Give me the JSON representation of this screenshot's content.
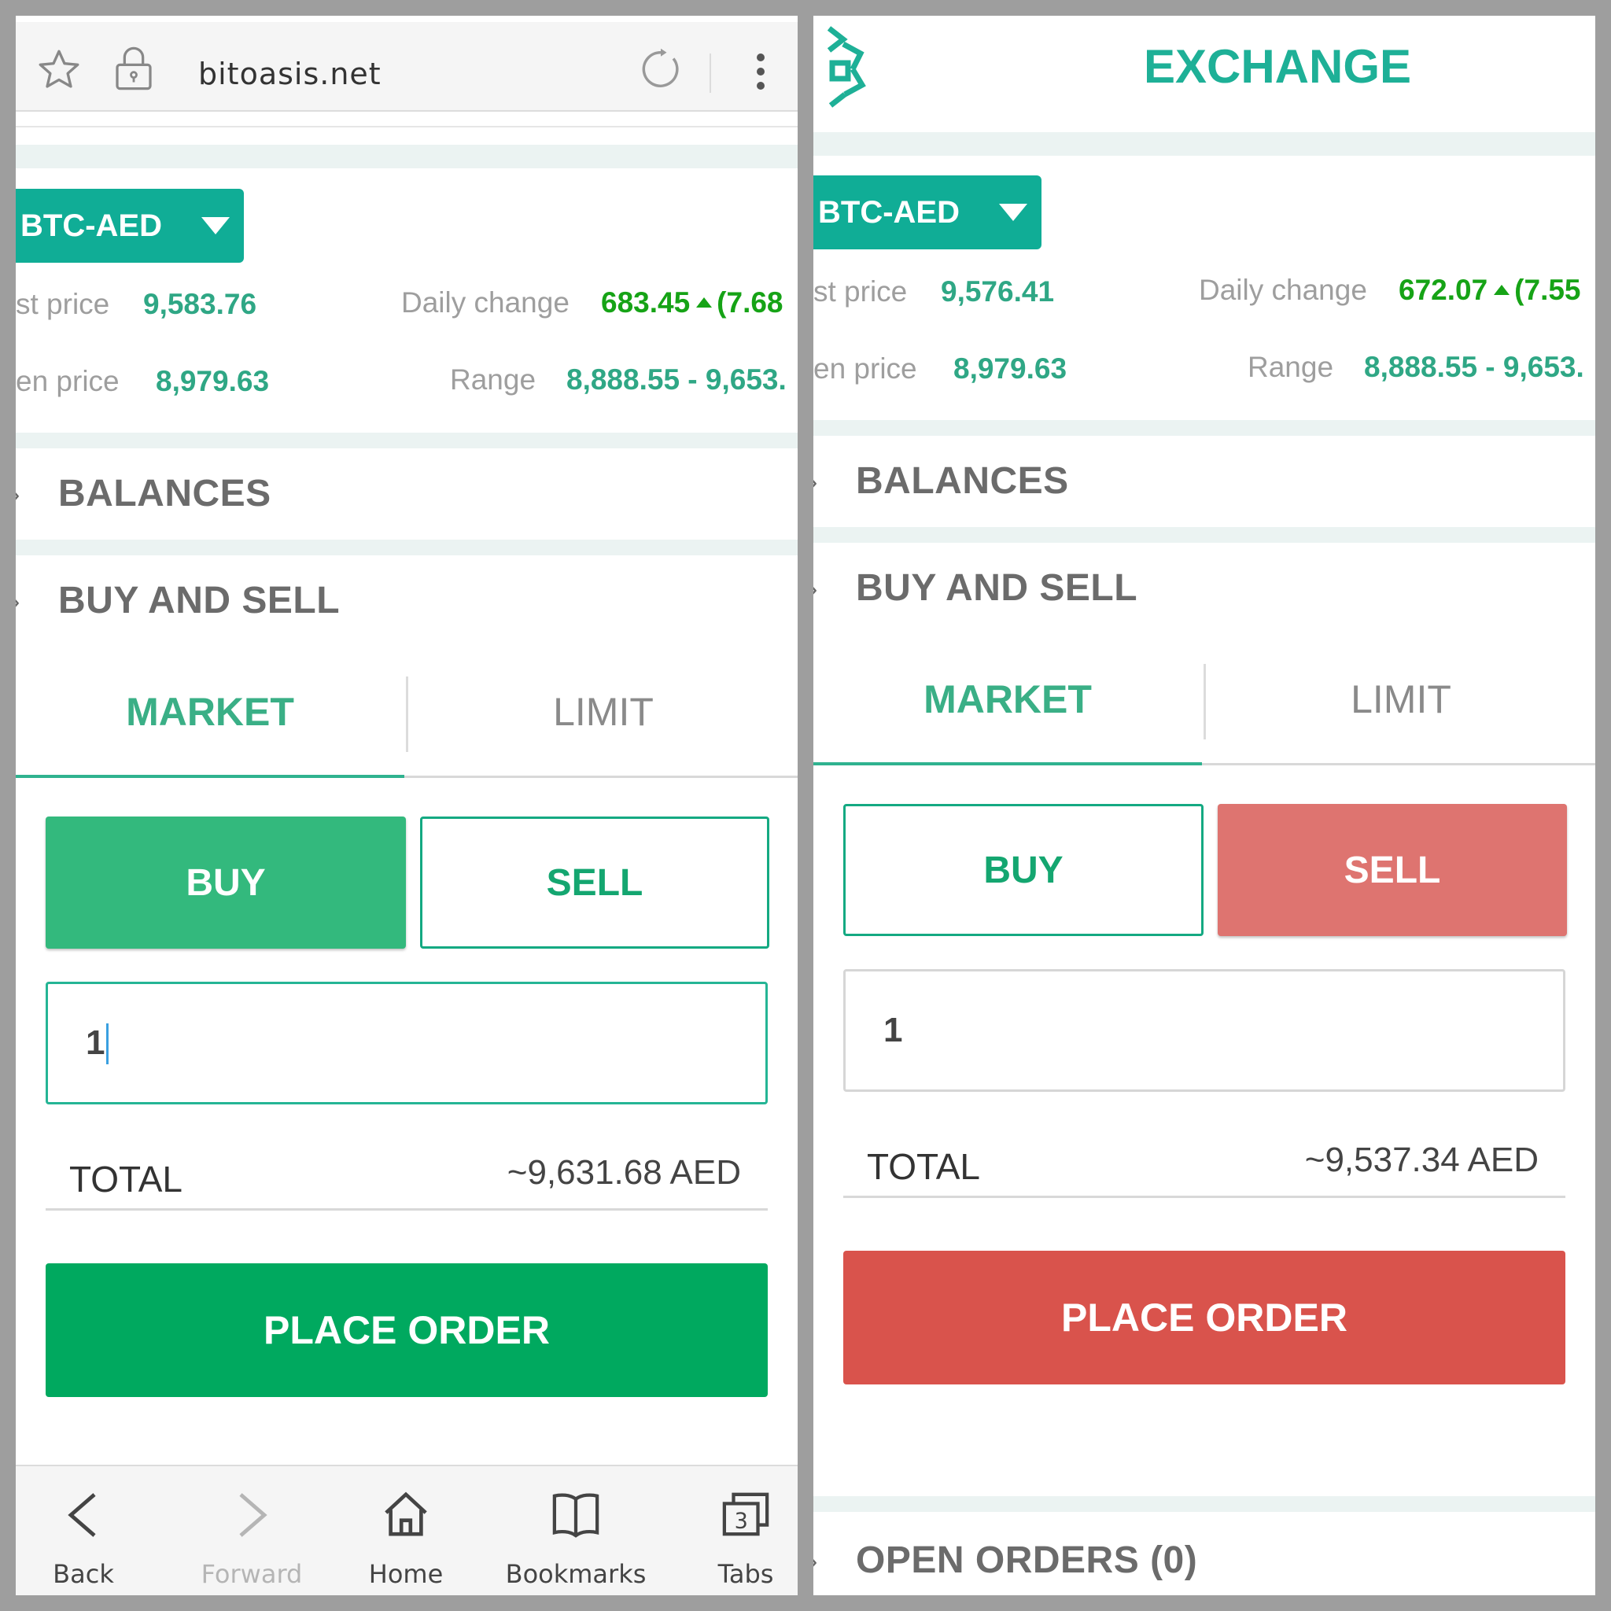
{
  "left": {
    "browser": {
      "url": "bitoasis.net"
    },
    "pair": "BTC-AED",
    "stats": {
      "last_price_label": "st price",
      "last_price": "9,583.76",
      "daily_change_label": "Daily change",
      "daily_change_value": "683.45",
      "daily_change_pct": "(7.68",
      "open_price_label": "en price",
      "open_price": "8,979.63",
      "range_label": "Range",
      "range_value": "8,888.55 - 9,653."
    },
    "sections": {
      "balances": "BALANCES",
      "buy_and_sell": "BUY AND SELL"
    },
    "tabs": {
      "market": "MARKET",
      "limit": "LIMIT"
    },
    "buy_label": "BUY",
    "sell_label": "SELL",
    "quantity": "1",
    "total_label": "TOTAL",
    "total_value": "~9,631.68 AED",
    "place_order": "PLACE ORDER",
    "nav": {
      "back": "Back",
      "forward": "Forward",
      "home": "Home",
      "bookmarks": "Bookmarks",
      "tabs": "Tabs",
      "tab_count": "3"
    }
  },
  "right": {
    "header_title": "EXCHANGE",
    "pair": "BTC-AED",
    "stats": {
      "last_price_label": "st price",
      "last_price": "9,576.41",
      "daily_change_label": "Daily change",
      "daily_change_value": "672.07",
      "daily_change_pct": "(7.55",
      "open_price_label": "en price",
      "open_price": "8,979.63",
      "range_label": "Range",
      "range_value": "8,888.55 - 9,653."
    },
    "sections": {
      "balances": "BALANCES",
      "buy_and_sell": "BUY AND SELL",
      "open_orders": "OPEN ORDERS (0)"
    },
    "tabs": {
      "market": "MARKET",
      "limit": "LIMIT"
    },
    "buy_label": "BUY",
    "sell_label": "SELL",
    "quantity": "1",
    "total_label": "TOTAL",
    "total_value": "~9,537.34 AED",
    "place_order": "PLACE ORDER"
  },
  "colors": {
    "brand_teal": "#10ad96",
    "buy_green": "#00a95f",
    "sell_red": "#d9534c",
    "change_green": "#16a316"
  },
  "icons": {
    "browser": [
      "star-icon",
      "lock-icon",
      "reload-icon",
      "overflow-menu-icon"
    ],
    "nav": [
      "back-arrow-icon",
      "forward-arrow-icon",
      "home-icon",
      "bookmarks-icon",
      "tabs-icon"
    ],
    "brand": "bitoasis-logo-icon"
  }
}
